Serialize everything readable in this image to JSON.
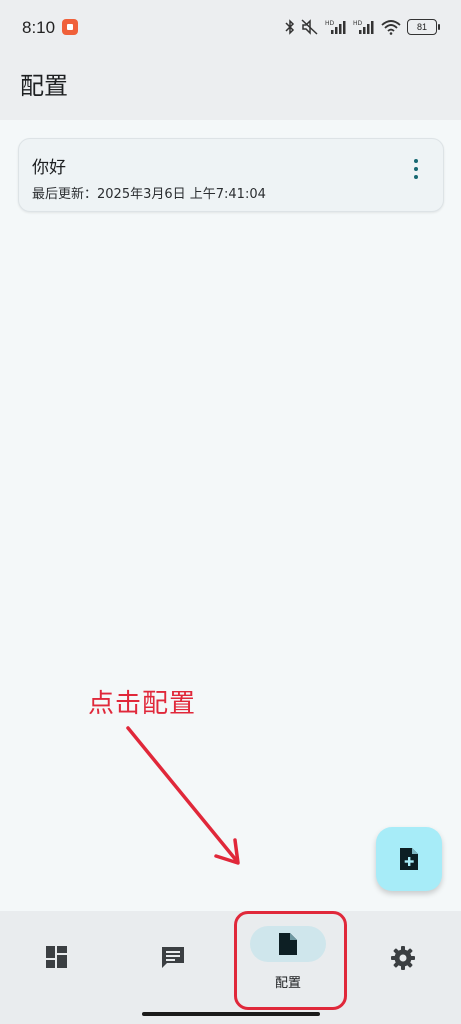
{
  "status_bar": {
    "time": "8:10",
    "battery": "81",
    "icons": [
      "bluetooth-icon",
      "mute-icon",
      "signal-hd-icon",
      "signal-hd-icon",
      "wifi-icon",
      "battery-icon"
    ]
  },
  "app_bar": {
    "title": "配置"
  },
  "config_list": [
    {
      "name": "你好",
      "updated": "最后更新：2025年3月6日 上午7:41:04"
    }
  ],
  "annotation": {
    "text": "点击配置",
    "color": "#e0283a"
  },
  "fab": {
    "icon": "add-file-icon",
    "color": "#a7ecf8"
  },
  "bottom_nav": {
    "items": [
      {
        "icon": "dashboard-icon"
      },
      {
        "icon": "chat-icon"
      },
      {
        "icon": "file-icon",
        "label": "配置",
        "selected": true
      },
      {
        "icon": "gear-icon"
      }
    ]
  },
  "colors": {
    "accent": "#176872",
    "nav_indicator": "#cfe6ec",
    "background": "#f4f8f9"
  }
}
